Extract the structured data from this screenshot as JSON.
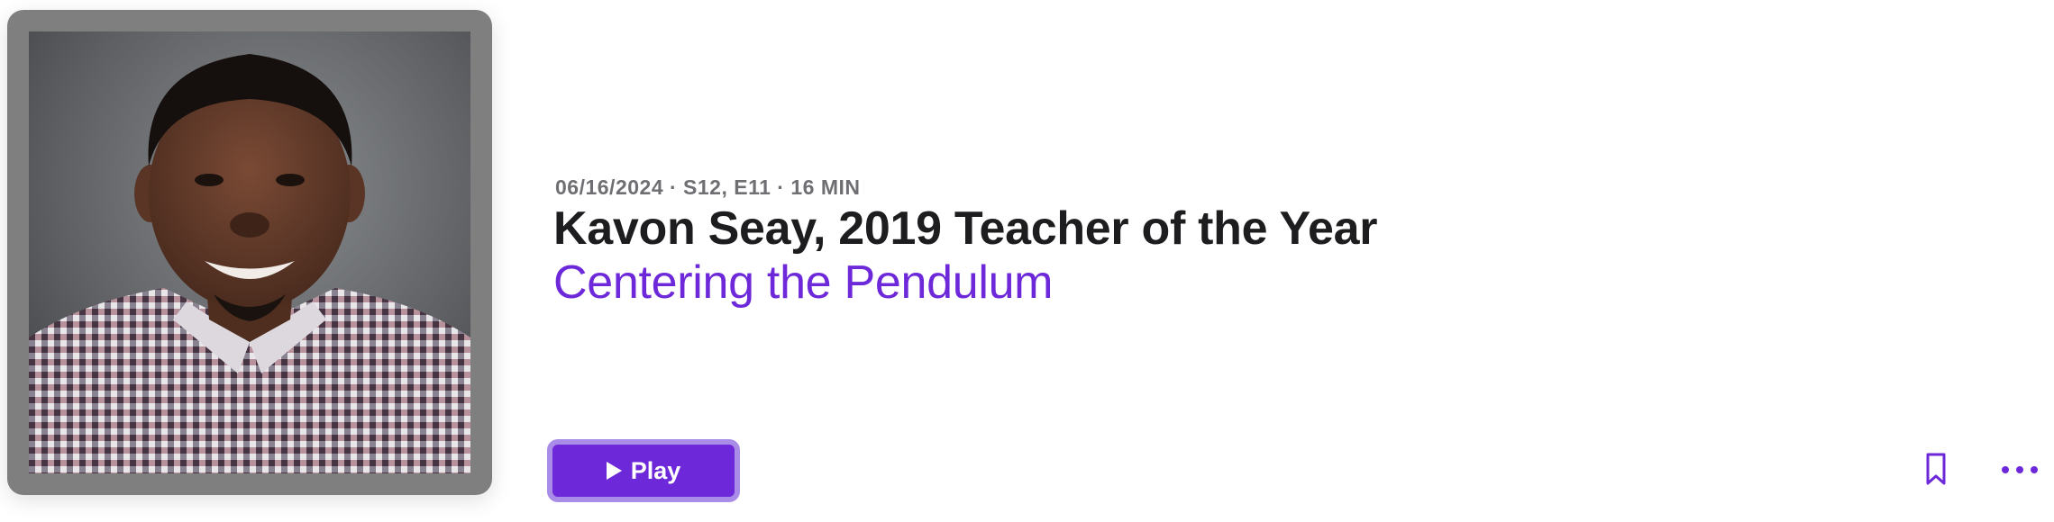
{
  "episode": {
    "meta": "06/16/2024 · S12, E11 · 16 MIN",
    "title": "Kavon Seay, 2019 Teacher of the Year",
    "show_name": "Centering the Pendulum"
  },
  "actions": {
    "play_label": "Play",
    "play_icon": "play-icon",
    "bookmark_icon": "bookmark-icon",
    "more_icon": "ellipsis-icon"
  },
  "colors": {
    "accent": "#6d28d9",
    "play_border": "#a98be8",
    "title_text": "#1d1d1f",
    "meta_text": "#6e6e73"
  }
}
